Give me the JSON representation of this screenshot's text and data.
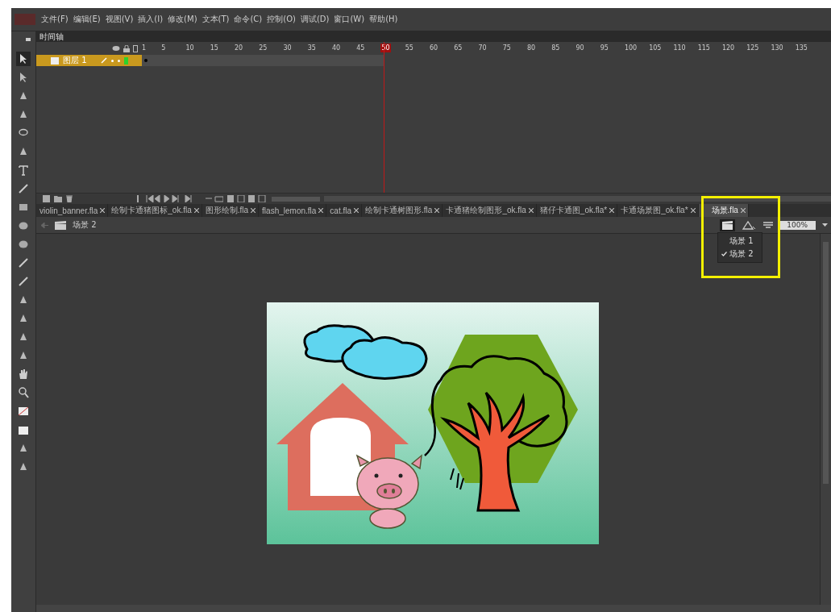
{
  "menu": [
    "文件(F)",
    "编辑(E)",
    "视图(V)",
    "插入(I)",
    "修改(M)",
    "文本(T)",
    "命令(C)",
    "控制(O)",
    "调试(D)",
    "窗口(W)",
    "帮助(H)"
  ],
  "timeline": {
    "title": "时间轴",
    "frame_numbers": [
      {
        "label": "1",
        "selected": false
      },
      {
        "label": "5",
        "selected": false
      },
      {
        "label": "10",
        "selected": false
      },
      {
        "label": "15",
        "selected": false
      },
      {
        "label": "20",
        "selected": false
      },
      {
        "label": "25",
        "selected": false
      },
      {
        "label": "30",
        "selected": false
      },
      {
        "label": "35",
        "selected": false
      },
      {
        "label": "40",
        "selected": false
      },
      {
        "label": "45",
        "selected": false
      },
      {
        "label": "50",
        "selected": true
      },
      {
        "label": "55",
        "selected": false
      },
      {
        "label": "60",
        "selected": false
      },
      {
        "label": "65",
        "selected": false
      },
      {
        "label": "70",
        "selected": false
      },
      {
        "label": "75",
        "selected": false
      },
      {
        "label": "80",
        "selected": false
      },
      {
        "label": "85",
        "selected": false
      },
      {
        "label": "90",
        "selected": false
      },
      {
        "label": "95",
        "selected": false
      },
      {
        "label": "100",
        "selected": false
      },
      {
        "label": "105",
        "selected": false
      },
      {
        "label": "110",
        "selected": false
      },
      {
        "label": "115",
        "selected": false
      },
      {
        "label": "120",
        "selected": false
      },
      {
        "label": "125",
        "selected": false
      },
      {
        "label": "130",
        "selected": false
      },
      {
        "label": "135",
        "selected": false
      }
    ],
    "layers": [
      {
        "name": "图层 1",
        "selected": true
      }
    ]
  },
  "document_tabs": [
    {
      "label": "violin_banner.fla",
      "selected": false
    },
    {
      "label": "绘制卡通猪图标_ok.fla",
      "selected": false
    },
    {
      "label": "图形绘制.fla",
      "selected": false
    },
    {
      "label": "flash_lemon.fla",
      "selected": false
    },
    {
      "label": "cat.fla",
      "selected": false
    },
    {
      "label": "绘制卡通树图形.fla",
      "selected": false
    },
    {
      "label": "卡通猪绘制图形_ok.fla",
      "selected": false
    },
    {
      "label": "猪仔卡通图_ok.fla*",
      "selected": false
    },
    {
      "label": "卡通场景图_ok.fla*",
      "selected": false
    },
    {
      "label": "场景.fla",
      "selected": true
    }
  ],
  "edit_bar": {
    "scene": "场景 2",
    "zoom": "100%"
  },
  "scene_menu": [
    {
      "label": "场景 1",
      "checked": false
    },
    {
      "label": "场景 2",
      "checked": true
    }
  ]
}
